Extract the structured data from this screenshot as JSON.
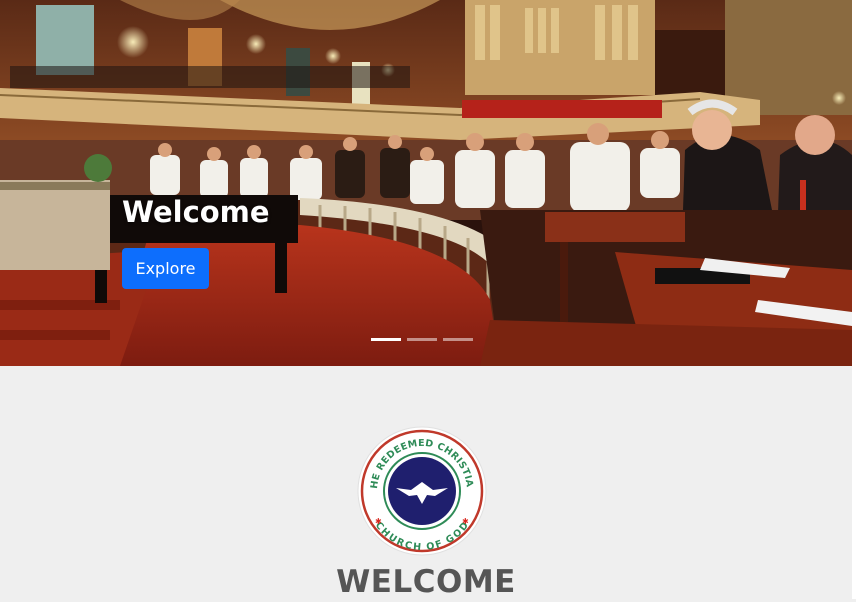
{
  "hero": {
    "title": "Welcome",
    "button_label": "Explore",
    "slides": 3,
    "active_slide": 1
  },
  "logo": {
    "text_top": "THE REDEEMED CHRISTIAN",
    "text_bottom": "CHURCH OF GOD",
    "ring_color": "#2e8b57",
    "disc_color": "#1f1f6e",
    "star_color": "#d9251d"
  },
  "section": {
    "heading": "WELCOME"
  },
  "colors": {
    "primary_button": "#0d6efd",
    "page_background": "#efefef",
    "heading_text": "#555555"
  }
}
